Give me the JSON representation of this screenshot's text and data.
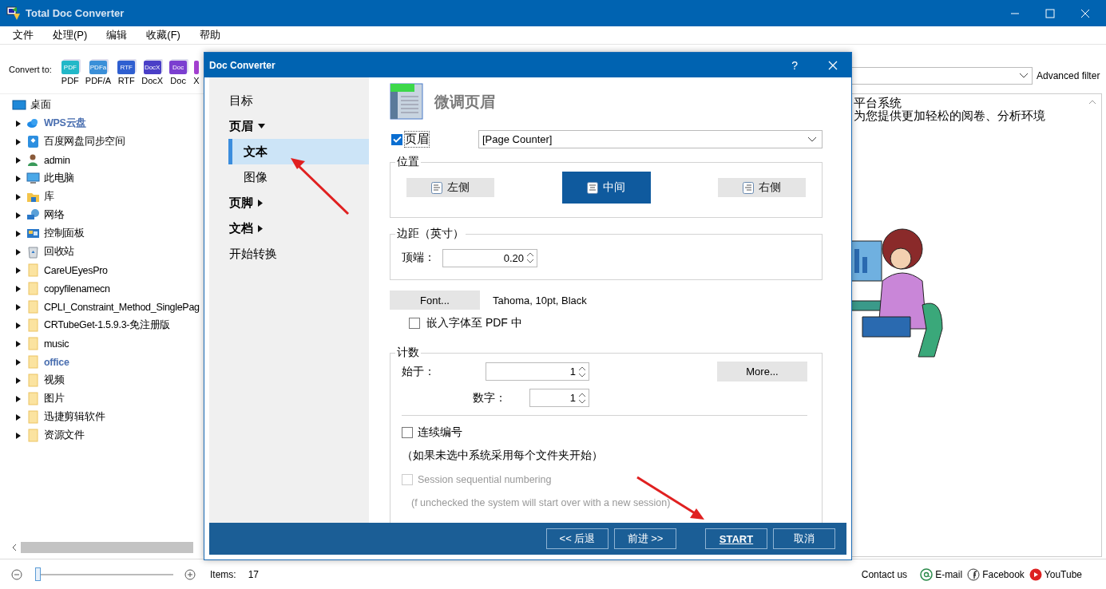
{
  "window": {
    "title": "Total Doc Converter"
  },
  "menu": [
    {
      "label": "文件"
    },
    {
      "label": "处理(P)"
    },
    {
      "label": "编辑"
    },
    {
      "label": "收藏(F)"
    },
    {
      "label": "帮助"
    }
  ],
  "toolbar": {
    "label": "Convert to:",
    "formats": [
      {
        "label": "PDF",
        "icon_text": "PDF",
        "color": "#22b8c8"
      },
      {
        "label": "PDF/A",
        "icon_text": "PDFa",
        "color": "#3a8fd8"
      },
      {
        "label": "RTF",
        "icon_text": "RTF",
        "color": "#2f5fd0"
      },
      {
        "label": "DocX",
        "icon_text": "DocX",
        "color": "#4a3fc7"
      },
      {
        "label": "Doc",
        "icon_text": "Doc",
        "color": "#7b3fd0"
      },
      {
        "label": "X",
        "color": "#a33fd0"
      }
    ]
  },
  "tree": {
    "root": {
      "label": "桌面"
    },
    "items": [
      {
        "label": "WPS云盘",
        "kind": "cloud",
        "highlighted": true
      },
      {
        "label": "百度网盘同步空间",
        "kind": "sync",
        "highlighted": false
      },
      {
        "label": "admin",
        "kind": "user",
        "highlighted": false
      },
      {
        "label": "此电脑",
        "kind": "computer",
        "highlighted": false
      },
      {
        "label": "库",
        "kind": "library",
        "highlighted": false
      },
      {
        "label": "网络",
        "kind": "network",
        "highlighted": false
      },
      {
        "label": "控制面板",
        "kind": "control",
        "highlighted": false
      },
      {
        "label": "回收站",
        "kind": "recycle",
        "highlighted": false
      },
      {
        "label": "CareUEyesPro",
        "kind": "folder",
        "highlighted": false
      },
      {
        "label": "copyfilenamecn",
        "kind": "folder",
        "highlighted": false
      },
      {
        "label": "CPLI_Constraint_Method_SinglePag",
        "kind": "folder",
        "highlighted": false
      },
      {
        "label": "CRTubeGet-1.5.9.3-免注册版",
        "kind": "folder",
        "highlighted": false
      },
      {
        "label": "music",
        "kind": "folder",
        "highlighted": false
      },
      {
        "label": "office",
        "kind": "folder",
        "highlighted": true
      },
      {
        "label": "视频",
        "kind": "folder",
        "highlighted": false
      },
      {
        "label": "图片",
        "kind": "folder",
        "highlighted": false
      },
      {
        "label": "迅捷剪辑软件",
        "kind": "folder",
        "highlighted": false
      },
      {
        "label": "资源文件",
        "kind": "folder",
        "highlighted": false
      }
    ]
  },
  "filter": {
    "label": "Advanced filter"
  },
  "preview": {
    "lines": [
      "平台系统",
      "为您提供更加轻松的阅卷、分析环境"
    ]
  },
  "status_bar": {
    "zoom": {
      "level": 0
    },
    "items_label": "Items:",
    "items_count": "17",
    "contact": "Contact us",
    "links": [
      {
        "label": "E-mail",
        "kind": "email"
      },
      {
        "label": "Facebook",
        "kind": "facebook"
      },
      {
        "label": "YouTube",
        "kind": "youtube"
      }
    ]
  },
  "dialog": {
    "title": "Doc Converter",
    "help": "?",
    "nav": [
      {
        "label": "目标",
        "kind": "item",
        "selected": false
      },
      {
        "label": "页眉",
        "kind": "group",
        "expanded": true,
        "selected": false,
        "children": [
          {
            "label": "文本",
            "selected": true
          },
          {
            "label": "图像",
            "selected": false
          }
        ]
      },
      {
        "label": "页脚",
        "kind": "group",
        "expanded": false,
        "selected": false
      },
      {
        "label": "文档",
        "kind": "group",
        "expanded": false,
        "selected": false
      },
      {
        "label": "开始转换",
        "kind": "item",
        "selected": false
      }
    ],
    "heading": "微调页眉",
    "header_toggle": {
      "label": "页眉",
      "checked": true
    },
    "header_value": "[Page Counter]",
    "position": {
      "legend": "位置",
      "options": [
        {
          "label": "左侧",
          "kind": "left",
          "selected": false
        },
        {
          "label": "中间",
          "kind": "center",
          "selected": true
        },
        {
          "label": "右侧",
          "kind": "right",
          "selected": false
        }
      ]
    },
    "margins": {
      "legend": "边距（英寸）",
      "top_label": "顶端：",
      "top_value": "0.20"
    },
    "font_button": "Font...",
    "font_desc": "Tahoma, 10pt, Black",
    "embed": {
      "label": "嵌入字体至 PDF 中",
      "checked": false
    },
    "counting": {
      "legend": "计数",
      "start_label": "始于：",
      "start_value": "1",
      "digits_label": "数字：",
      "digits_value": "1",
      "more_button": "More...",
      "continuous": {
        "label": "连续编号",
        "checked": false,
        "disabled": false
      },
      "continuous_note": "（如果未选中系统采用每个文件夹开始）",
      "session": {
        "label": "Session sequential numbering",
        "checked": false,
        "disabled": true
      },
      "session_note": "(f unchecked the system will start over with a new session)"
    },
    "buttons": [
      {
        "label": "<< 后退",
        "kind": "normal"
      },
      {
        "label": "前进 >>",
        "kind": "normal"
      },
      {
        "label": "START",
        "kind": "primary"
      },
      {
        "label": "取消",
        "kind": "normal"
      }
    ]
  }
}
